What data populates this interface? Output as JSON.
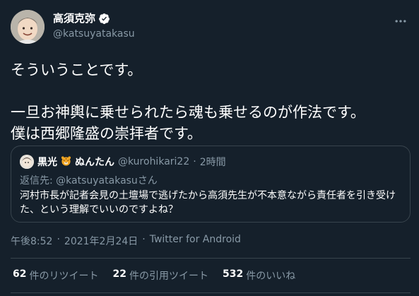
{
  "author": {
    "name": "高須克弥",
    "handle": "@katsuyatakasu"
  },
  "tweet": {
    "text": "そういうことです。\n\n一旦お神輿に乗せられたら魂も乗せるのが作法です。\n僕は西郷隆盛の崇拝者です。"
  },
  "quoted": {
    "name": "黒光",
    "name_suffix": "ぬんたん",
    "emoji_icon": "tiger-face-icon",
    "handle": "@kurohikari22",
    "dot": "·",
    "time": "2時間",
    "reply_prefix": "返信先: ",
    "reply_handle": "@katsuyatakasu",
    "reply_suffix": "さん",
    "text": "河村市長が記者会見の土壇場で逃げたから高須先生が不本意ながら責任者を引き受けた、という理解でいいのですよね？"
  },
  "meta": {
    "time": "午後8:52",
    "sep1": "·",
    "date": "2021年2月24日",
    "sep2": "·",
    "source": "Twitter for Android"
  },
  "stats": {
    "retweets_count": "62",
    "retweets_label": "件のリツイート",
    "quotes_count": "22",
    "quotes_label": "件の引用ツイート",
    "likes_count": "532",
    "likes_label": "件のいいね"
  },
  "colors": {
    "background": "#15202b",
    "secondary_text": "#8899a6",
    "border": "#38444d",
    "verified": "#ffffff"
  }
}
